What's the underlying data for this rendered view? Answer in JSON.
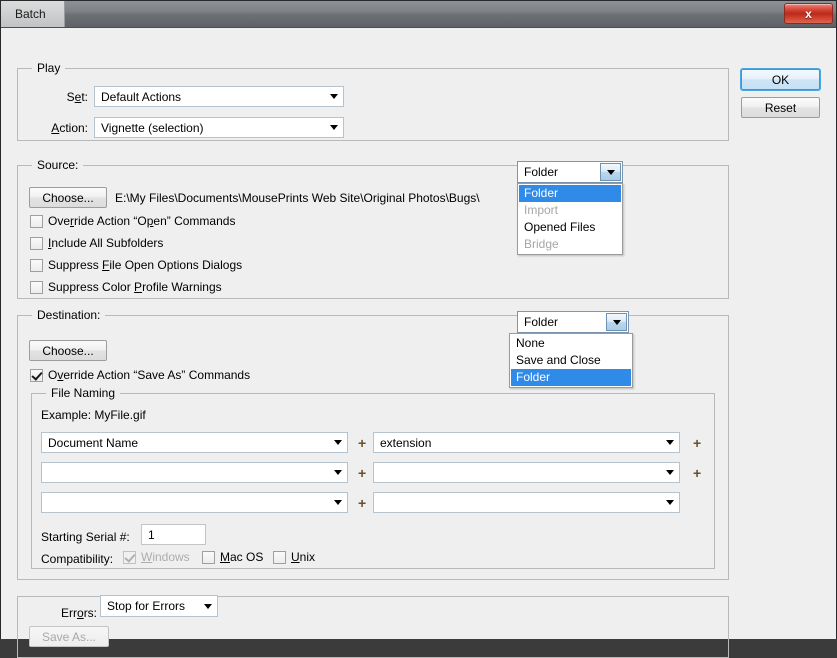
{
  "window": {
    "title": "Batch",
    "close_glyph": "x"
  },
  "actions": {
    "ok_label": "OK",
    "reset_label": "Reset"
  },
  "play": {
    "group_title": "Play",
    "set_label": "Set:",
    "set_value": "Default Actions",
    "action_label": "Action:",
    "action_value": "Vignette (selection)"
  },
  "source": {
    "group_title": "Source:",
    "choose_label": "Choose...",
    "path": "E:\\My Files\\Documents\\MousePrints Web Site\\Original Photos\\Bugs\\",
    "combo_value": "Folder",
    "options": [
      {
        "label": "Folder",
        "state": "selected"
      },
      {
        "label": "Import",
        "state": "disabled"
      },
      {
        "label": "Opened Files",
        "state": "normal"
      },
      {
        "label": "Bridge",
        "state": "disabled"
      }
    ],
    "checkboxes": [
      {
        "label": "Override Action “Open” Commands",
        "checked": false
      },
      {
        "label": "Include All Subfolders",
        "checked": false
      },
      {
        "label": "Suppress File Open Options Dialogs",
        "checked": false
      },
      {
        "label": "Suppress Color Profile Warnings",
        "checked": false
      }
    ]
  },
  "destination": {
    "group_title": "Destination:",
    "choose_label": "Choose...",
    "combo_value": "Folder",
    "options": [
      {
        "label": "None",
        "state": "normal"
      },
      {
        "label": "Save and Close",
        "state": "normal"
      },
      {
        "label": "Folder",
        "state": "selected"
      }
    ],
    "override_save_as_label": "Override Action “Save As” Commands",
    "override_save_as_checked": true
  },
  "file_naming": {
    "group_title": "File Naming",
    "example_label": "Example: MyFile.gif",
    "fields": [
      "Document Name",
      "extension",
      "",
      "",
      "",
      ""
    ],
    "plus_label": "+",
    "serial_label": "Starting Serial #:",
    "serial_value": "1",
    "compatibility_label": "Compatibility:",
    "compat": [
      {
        "label": "Windows",
        "checked": true,
        "disabled": true
      },
      {
        "label": "Mac OS",
        "checked": false,
        "disabled": false
      },
      {
        "label": "Unix",
        "checked": false,
        "disabled": false
      }
    ]
  },
  "errors": {
    "label": "Errors:",
    "value": "Stop for Errors",
    "save_as_label": "Save As...",
    "save_as_disabled": true
  },
  "colors": {
    "accent": "#2f8ae8",
    "dialog_bg": "#efefef",
    "close_red": "#b82a1c",
    "plus_brown": "#6a4f2a"
  }
}
